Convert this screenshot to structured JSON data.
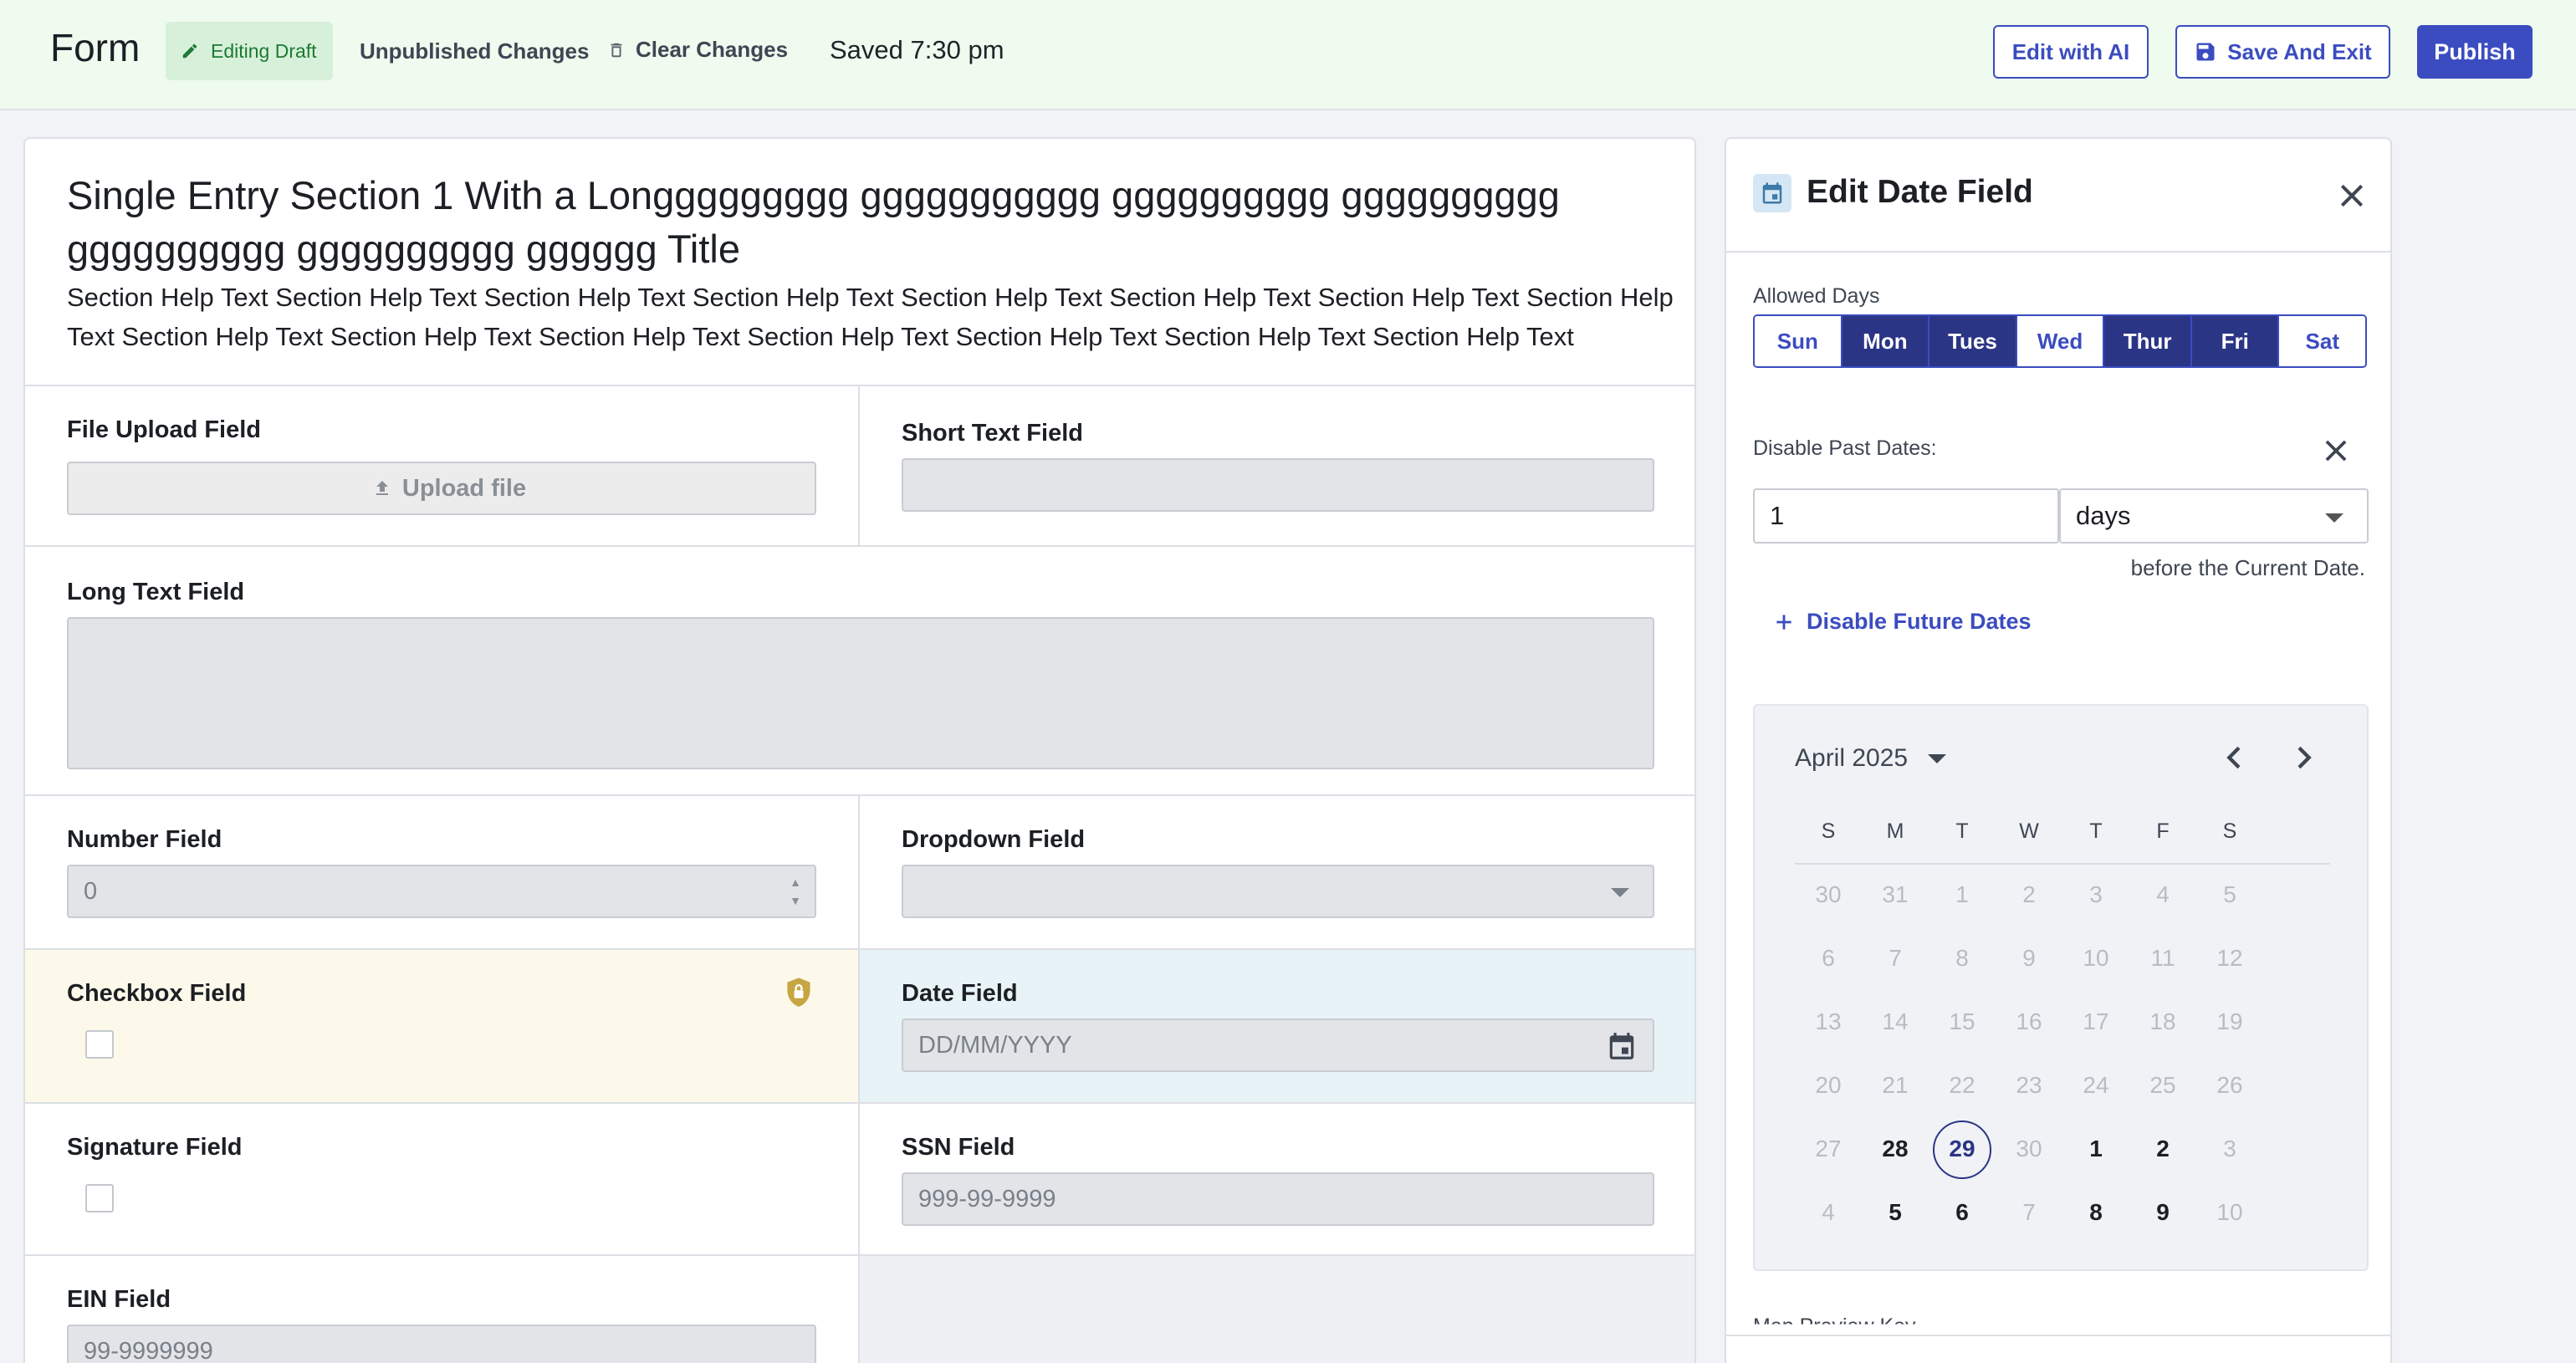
{
  "header": {
    "brand": "Form",
    "editing_draft": "Editing Draft",
    "unpublished": "Unpublished Changes",
    "clear_changes": "Clear Changes",
    "saved": "Saved 7:30 pm",
    "edit_ai": "Edit with AI",
    "save_exit": "Save And Exit",
    "publish": "Publish"
  },
  "section": {
    "title": "Single Entry Section 1 With a Longgggggggg ggggggggggg gggggggggg gggggggggg gggggggggg gggggggggg gggggg Title",
    "help": "Section Help Text Section Help Text Section Help Text Section Help Text Section Help Text Section Help Text Section Help Text Section Help Text Section Help Text Section Help Text Section Help Text Section Help Text Section Help Text Section Help Text Section Help Text"
  },
  "fields": {
    "file_upload": {
      "label": "File Upload Field",
      "button": "Upload file"
    },
    "short_text": {
      "label": "Short Text Field"
    },
    "long_text": {
      "label": "Long Text Field"
    },
    "number": {
      "label": "Number Field",
      "value": "0"
    },
    "dropdown": {
      "label": "Dropdown Field"
    },
    "checkbox": {
      "label": "Checkbox Field"
    },
    "date": {
      "label": "Date Field",
      "placeholder": "DD/MM/YYYY"
    },
    "signature": {
      "label": "Signature Field"
    },
    "ssn": {
      "label": "SSN Field",
      "placeholder": "999-99-9999"
    },
    "ein": {
      "label": "EIN Field",
      "placeholder": "99-9999999"
    }
  },
  "panel": {
    "title": "Edit Date Field",
    "allowed_days_label": "Allowed Days",
    "days": [
      {
        "label": "Sun",
        "on": false
      },
      {
        "label": "Mon",
        "on": true
      },
      {
        "label": "Tues",
        "on": true
      },
      {
        "label": "Wed",
        "on": false
      },
      {
        "label": "Thur",
        "on": true
      },
      {
        "label": "Fri",
        "on": true
      },
      {
        "label": "Sat",
        "on": false
      }
    ],
    "disable_past_label": "Disable Past Dates:",
    "past_value": "1",
    "past_unit": "days",
    "helper": "before the Current Date.",
    "disable_future": "Disable Future Dates",
    "calendar": {
      "month": "April 2025",
      "weekdays": [
        "S",
        "M",
        "T",
        "W",
        "T",
        "F",
        "S"
      ],
      "weeks": [
        [
          "30",
          "31",
          "1",
          "2",
          "3",
          "4",
          "5"
        ],
        [
          "6",
          "7",
          "8",
          "9",
          "10",
          "11",
          "12"
        ],
        [
          "13",
          "14",
          "15",
          "16",
          "17",
          "18",
          "19"
        ],
        [
          "20",
          "21",
          "22",
          "23",
          "24",
          "25",
          "26"
        ],
        [
          "27",
          "28",
          "29",
          "30",
          "1",
          "2",
          "3"
        ],
        [
          "4",
          "5",
          "6",
          "7",
          "8",
          "9",
          "10"
        ]
      ],
      "enabled": [
        "28",
        "29",
        "1",
        "2",
        "5",
        "6",
        "8",
        "9"
      ],
      "selected": "29"
    },
    "cut_label": "Map Preview Key"
  }
}
